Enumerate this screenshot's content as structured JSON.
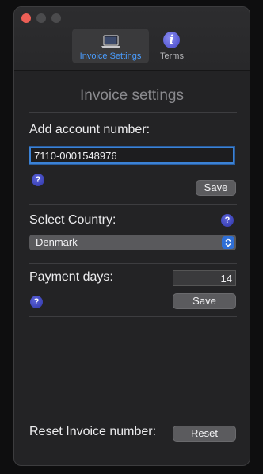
{
  "window": {
    "controls": [
      "close",
      "minimize",
      "maximize"
    ]
  },
  "toolbar": {
    "tabs": [
      {
        "label": "Invoice Settings",
        "icon": "laptop-icon",
        "selected": true
      },
      {
        "label": "Terms",
        "icon": "info-icon",
        "selected": false
      }
    ]
  },
  "main": {
    "title": "Invoice settings",
    "account": {
      "label": "Add account number:",
      "value": "7110-0001548976",
      "help": "?",
      "save_label": "Save"
    },
    "country": {
      "label": "Select Country:",
      "help": "?",
      "selected": "Denmark"
    },
    "payment": {
      "label": "Payment days:",
      "value": "14",
      "help": "?",
      "save_label": "Save"
    },
    "reset": {
      "label": "Reset Invoice number:",
      "button_label": "Reset"
    }
  },
  "colors": {
    "accent": "#4a9dff",
    "close": "#ec5f56",
    "help": "#3c43c0"
  }
}
